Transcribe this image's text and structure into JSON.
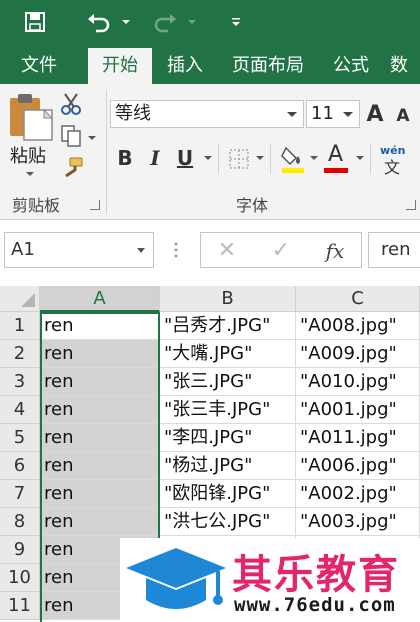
{
  "colors": {
    "brand": "#217346",
    "watermark_title": "#e3266b",
    "watermark_icon": "#1e88d6"
  },
  "quick_access": [
    {
      "name": "save-icon"
    },
    {
      "name": "undo-icon"
    },
    {
      "name": "redo-icon"
    },
    {
      "name": "customize-qat-icon"
    }
  ],
  "tabs": [
    "文件",
    "开始",
    "插入",
    "页面布局",
    "公式",
    "数"
  ],
  "active_tab": "开始",
  "ribbon": {
    "clipboard": {
      "paste_label": "粘贴",
      "group_label": "剪贴板"
    },
    "font": {
      "group_label": "字体",
      "font_name": "等线",
      "font_size": "11",
      "bold": "B",
      "italic": "I",
      "underline": "U",
      "font_color_letter": "A",
      "pinyin_label": "wén",
      "pinyin_char": "文",
      "grow_letter": "A",
      "shrink_letter": "A"
    }
  },
  "formula_bar": {
    "name_box": "A1",
    "fx": "fx",
    "cancel": "✕",
    "enter": "✓",
    "formula": "ren"
  },
  "grid": {
    "columns": [
      "A",
      "B",
      "C"
    ],
    "rows": [
      {
        "num": "1",
        "a": "ren",
        "b": "\"吕秀才.JPG\"",
        "c": "\"A008.jpg\""
      },
      {
        "num": "2",
        "a": "ren",
        "b": "\"大嘴.JPG\"",
        "c": "\"A009.jpg\""
      },
      {
        "num": "3",
        "a": "ren",
        "b": "\"张三.JPG\"",
        "c": "\"A010.jpg\""
      },
      {
        "num": "4",
        "a": "ren",
        "b": "\"张三丰.JPG\"",
        "c": "\"A001.jpg\""
      },
      {
        "num": "5",
        "a": "ren",
        "b": "\"李四.JPG\"",
        "c": "\"A011.jpg\""
      },
      {
        "num": "6",
        "a": "ren",
        "b": "\"杨过.JPG\"",
        "c": "\"A006.jpg\""
      },
      {
        "num": "7",
        "a": "ren",
        "b": "\"欧阳锋.JPG\"",
        "c": "\"A002.jpg\""
      },
      {
        "num": "8",
        "a": "ren",
        "b": "\"洪七公.JPG\"",
        "c": "\"A003.jpg\""
      },
      {
        "num": "9",
        "a": "ren",
        "b": "",
        "c": ""
      },
      {
        "num": "10",
        "a": "ren",
        "b": "",
        "c": ""
      },
      {
        "num": "11",
        "a": "ren",
        "b": "",
        "c": ""
      }
    ]
  },
  "watermark": {
    "title": "其乐教育",
    "url": "www.76edu.com"
  }
}
